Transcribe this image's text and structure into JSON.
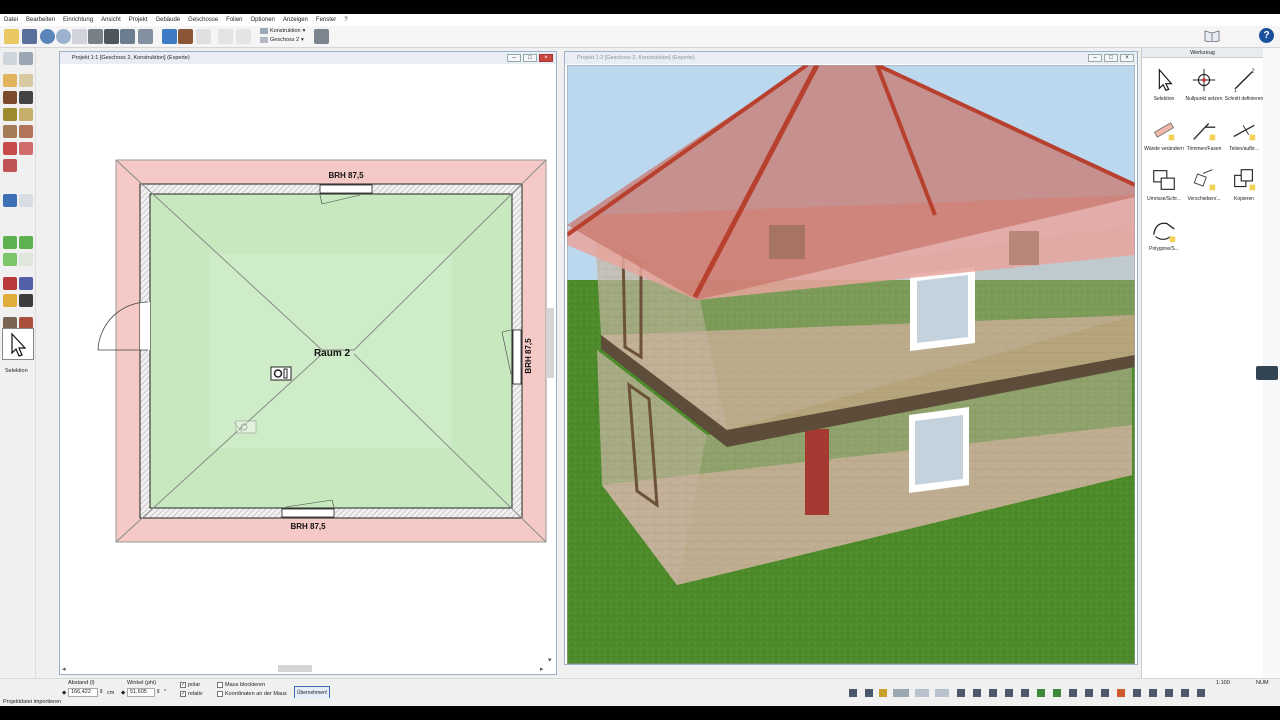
{
  "menu": [
    "Datei",
    "Bearbeiten",
    "Einrichtung",
    "Ansicht",
    "Projekt",
    "Gebäude",
    "Geschosse",
    "Folien",
    "Optionen",
    "Anzeigen",
    "Fenster",
    "?"
  ],
  "toolbar": {
    "view_mode": "Konstruktion",
    "floor": "Geschoss 2",
    "help_label": "?"
  },
  "left_tools": {
    "selection_label": "Selektion"
  },
  "plan_window": {
    "title": "Projekt 1:1 [Geschoss 2, Konstruktion] (Experte)",
    "room_label": "Raum 2",
    "window_top_label": "BRH 87,5",
    "window_right_label": "BRH 87,5",
    "window_bottom_label": "BRH 87,5",
    "btn_min": "–",
    "btn_max": "□",
    "btn_close": "×"
  },
  "view3d_window": {
    "title": "Projekt 1:2 [Geschoss 2, Konstruktion] (Experte)",
    "btn_min": "–",
    "btn_max": "□",
    "btn_close": "×"
  },
  "tool_panel": {
    "title": "Werkzeug",
    "tools": [
      {
        "label": "Selektion",
        "icon": "cursor-icon"
      },
      {
        "label": "Nullpunkt setzen",
        "icon": "crosshair-icon"
      },
      {
        "label": "Schnitt definieren",
        "icon": "section-line-icon"
      },
      {
        "label": "Wände verändern",
        "icon": "wall-edit-icon"
      },
      {
        "label": "Trimmen/Fasen",
        "icon": "trim-icon"
      },
      {
        "label": "Teilen/aufbr...",
        "icon": "split-icon"
      },
      {
        "label": "Umrisse/Schr...",
        "icon": "outline-icon"
      },
      {
        "label": "Verschieben/...",
        "icon": "move-icon"
      },
      {
        "label": "Kopieren",
        "icon": "copy-icon"
      },
      {
        "label": "Polygone/S...",
        "icon": "polygon-icon"
      }
    ]
  },
  "bottom": {
    "distance_label": "Abstand (l)",
    "distance_value": "166,422",
    "distance_unit": "cm",
    "angle_label": "Winkel (phi)",
    "angle_value": "51,605",
    "angle_unit": "°",
    "polar_label": "polar",
    "relative_label": "relativ",
    "lock_mouse_label": "Maus blockieren",
    "coords_label": "Koordinaten an der Maus",
    "apply_label": "Übernehmen!"
  },
  "status": {
    "text": "Projektdatei importieren",
    "scale": "1:100",
    "num": "NUM"
  },
  "colors": {
    "plan_room_fill": "#c8e8c0",
    "plan_outer_fill": "#f5c9c6",
    "roof_color": "#c8786c",
    "grass": "#4c8a2a",
    "sky": "#bcd8ee",
    "help_blue": "#1a4f9c"
  }
}
